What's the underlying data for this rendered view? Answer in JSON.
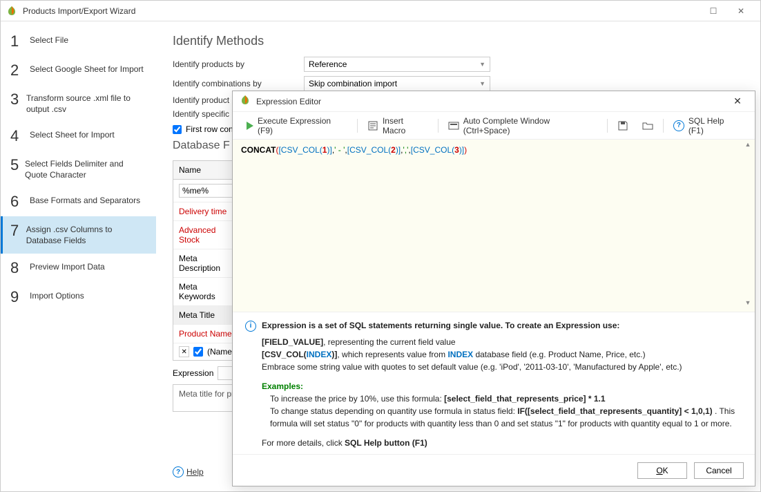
{
  "window_title": "Products Import/Export Wizard",
  "steps": [
    {
      "num": "1",
      "label": "Select File"
    },
    {
      "num": "2",
      "label": "Select Google Sheet for Import"
    },
    {
      "num": "3",
      "label": "Transform source .xml file to output .csv"
    },
    {
      "num": "4",
      "label": "Select Sheet for Import"
    },
    {
      "num": "5",
      "label": "Select Fields Delimiter and Quote Character"
    },
    {
      "num": "6",
      "label": "Base Formats and Separators"
    },
    {
      "num": "7",
      "label": "Assign .csv Columns to Database Fields"
    },
    {
      "num": "8",
      "label": "Preview Import Data"
    },
    {
      "num": "9",
      "label": "Import Options"
    }
  ],
  "active_step": 7,
  "section": {
    "title": "Identify Methods",
    "rows": [
      {
        "label": "Identify products by",
        "value": "Reference"
      },
      {
        "label": "Identify combinations by",
        "value": "Skip combination import"
      },
      {
        "label": "Identify product",
        "value": ""
      },
      {
        "label": "Identify specific",
        "value": ""
      }
    ],
    "first_row_label": "First row con",
    "db_title": "Database F",
    "name_header": "Name",
    "filter_value": "%me%",
    "rows_db": [
      {
        "label": "Delivery time",
        "kind": "red"
      },
      {
        "label": "Advanced Stock",
        "kind": "red"
      },
      {
        "label": "Meta Description",
        "kind": ""
      },
      {
        "label": "Meta Keywords",
        "kind": ""
      },
      {
        "label": "Meta Title",
        "kind": "sel"
      },
      {
        "label": "Product Name",
        "kind": "red prod"
      }
    ],
    "prod_sub_label": "(Name",
    "expr_label": "Expression",
    "desc_text": "Meta title for pr\nunique title"
  },
  "help_label": "Help",
  "modal": {
    "title": "Expression Editor",
    "toolbar": {
      "execute": "Execute Expression (F9)",
      "insert_macro": "Insert Macro",
      "autocomplete": "Auto Complete Window (Ctrl+Space)",
      "sql_help": "SQL Help (F1)"
    },
    "code": {
      "kw": "CONCAT",
      "s1": "[CSV_COL(",
      "n1": "1",
      "s2": ")]",
      "lit1": "' - '",
      "s3": "[CSV_COL(",
      "n2": "2",
      "s4": ")]",
      "lit2": "','",
      "s5": "[CSV_COL(",
      "n3": "3",
      "s6": ")]"
    },
    "info": {
      "intro": "Expression is a set of SQL statements returning single value. To create an Expression use:",
      "l1a": "[FIELD_VALUE]",
      "l1b": ", representing the current field value",
      "l2a": "[CSV_COL(",
      "l2idx": "INDEX",
      "l2b": ")]",
      "l2c": ", which represents value from ",
      "l2idx2": "INDEX",
      "l2d": " database field (e.g. Product Name, Price, etc.)",
      "l3": "Embrace some string value with quotes to set default value (e.g. 'iPod', '2011-03-10', 'Manufactured by Apple', etc.)",
      "examples_label": "Examples:",
      "ex1a": "To increase the price by 10%, use this formula: ",
      "ex1b": "[select_field_that_represents_price] * 1.1",
      "ex2a": "To change status depending on quantity use formula in status field: ",
      "ex2b": "IF([select_field_that_represents_quantity] < 1,0,1)",
      "ex2c": " . This formula will set status \"0\" for products with quantity less than 0 and set status \"1\" for products with quantity equal to 1 or more.",
      "more1": "For more details, click ",
      "more2": "SQL Help button (F1)"
    },
    "ok_label": "OK",
    "cancel_label": "Cancel"
  }
}
